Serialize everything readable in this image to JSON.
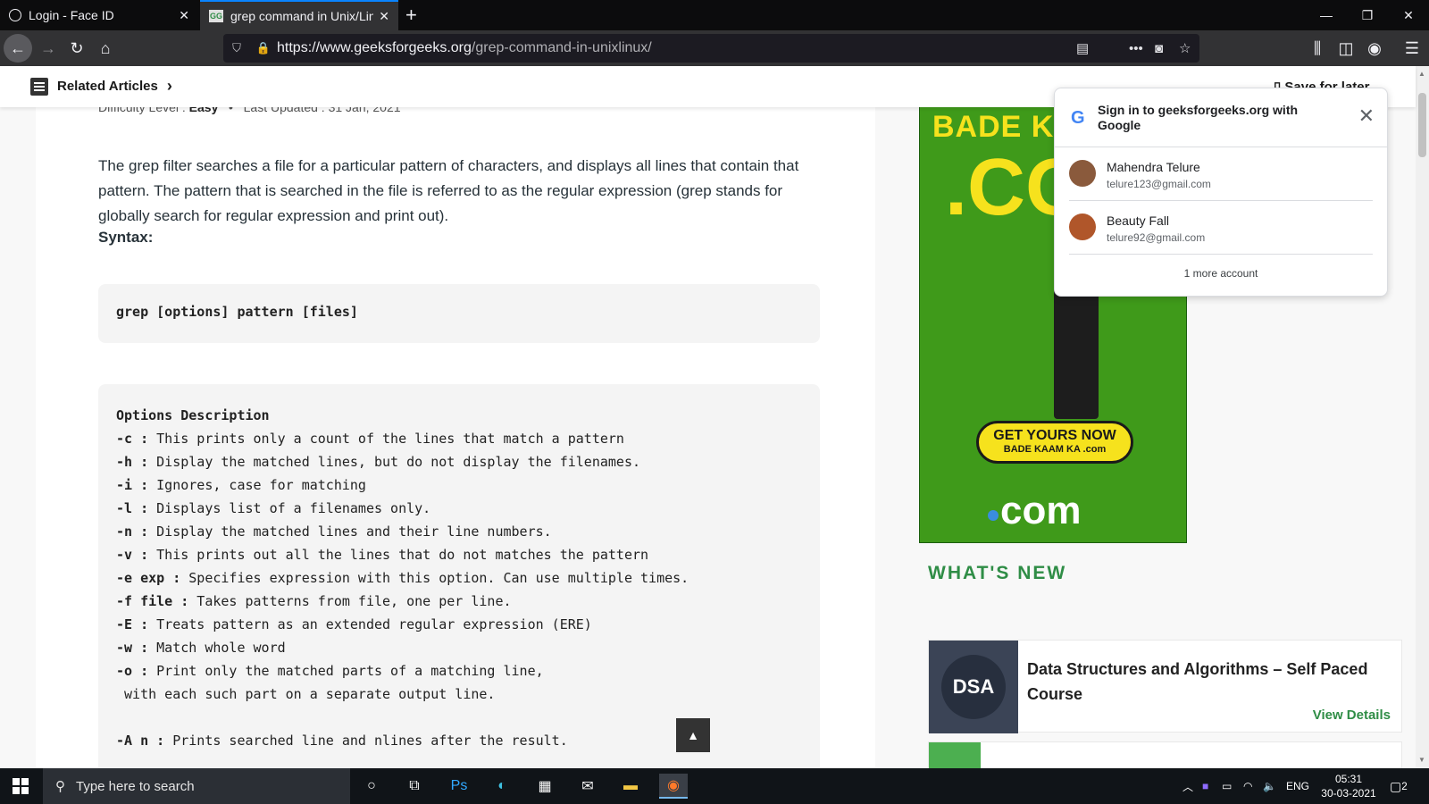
{
  "browser": {
    "tabs": [
      {
        "title": "Login - Face ID"
      },
      {
        "title": "grep command in Unix/Lin"
      }
    ],
    "url_host": "https://www.geeksforgeeks.org",
    "url_path": "/grep-command-in-unixlinux/"
  },
  "sticky": {
    "related": "Related Articles",
    "save_later": "Save for later"
  },
  "article": {
    "difficulty_label": "Difficulty Level :",
    "difficulty_value": "Easy",
    "updated": "Last Updated : 31 Jan, 2021",
    "intro": "The grep filter searches a file for a particular pattern of characters, and displays all lines that contain that pattern. The pattern that is searched in the file is referred to as the regular expression (grep stands for globally search for regular expression and print out).",
    "syntax_label": "Syntax:",
    "syntax_code": "grep [options] pattern [files]",
    "options_header": "Options Description",
    "options": [
      {
        "flag": "-c :",
        "desc": " This prints only a count of the lines that match a pattern"
      },
      {
        "flag": "-h :",
        "desc": " Display the matched lines, but do not display the filenames."
      },
      {
        "flag": "-i :",
        "desc": " Ignores, case for matching"
      },
      {
        "flag": "-l :",
        "desc": " Displays list of a filenames only."
      },
      {
        "flag": "-n :",
        "desc": " Display the matched lines and their line numbers."
      },
      {
        "flag": "-v :",
        "desc": " This prints out all the lines that do not matches the pattern"
      },
      {
        "flag": "-e exp :",
        "desc": " Specifies expression with this option. Can use multiple times."
      },
      {
        "flag": "-f file :",
        "desc": " Takes patterns from file, one per line."
      },
      {
        "flag": "-E :",
        "desc": " Treats pattern as an extended regular expression (ERE)"
      },
      {
        "flag": "-w :",
        "desc": " Match whole word"
      },
      {
        "flag": "-o :",
        "desc": " Print only the matched parts of a matching line,"
      },
      {
        "flag": "",
        "desc": " with each such part on a separate output line."
      },
      {
        "flag": "",
        "desc": ""
      },
      {
        "flag": "-A n :",
        "desc": " Prints searched line and nlines after the result."
      }
    ]
  },
  "ad": {
    "top_text": "BADE KA",
    "big_text": ".CO",
    "cta": "GET YOURS NOW",
    "cta_sub": "BADE KAAM KA .com",
    "com": "com"
  },
  "sidebar": {
    "whats_new": "WHAT'S NEW",
    "card_title": "Data Structures and Algorithms – Self Paced Course",
    "card_img_text": "DSA",
    "card_link": "View Details"
  },
  "google_signin": {
    "title": "Sign in to geeksforgeeks.org with Google",
    "accounts": [
      {
        "name": "Mahendra Telure",
        "email": "telure123@gmail.com",
        "color": "#8a5a3c"
      },
      {
        "name": "Beauty Fall",
        "email": "telure92@gmail.com",
        "color": "#b0562a"
      }
    ],
    "more": "1 more account"
  },
  "taskbar": {
    "search_placeholder": "Type here to search",
    "lang": "ENG",
    "time": "05:31",
    "date": "30-03-2021",
    "notif_count": "2"
  }
}
